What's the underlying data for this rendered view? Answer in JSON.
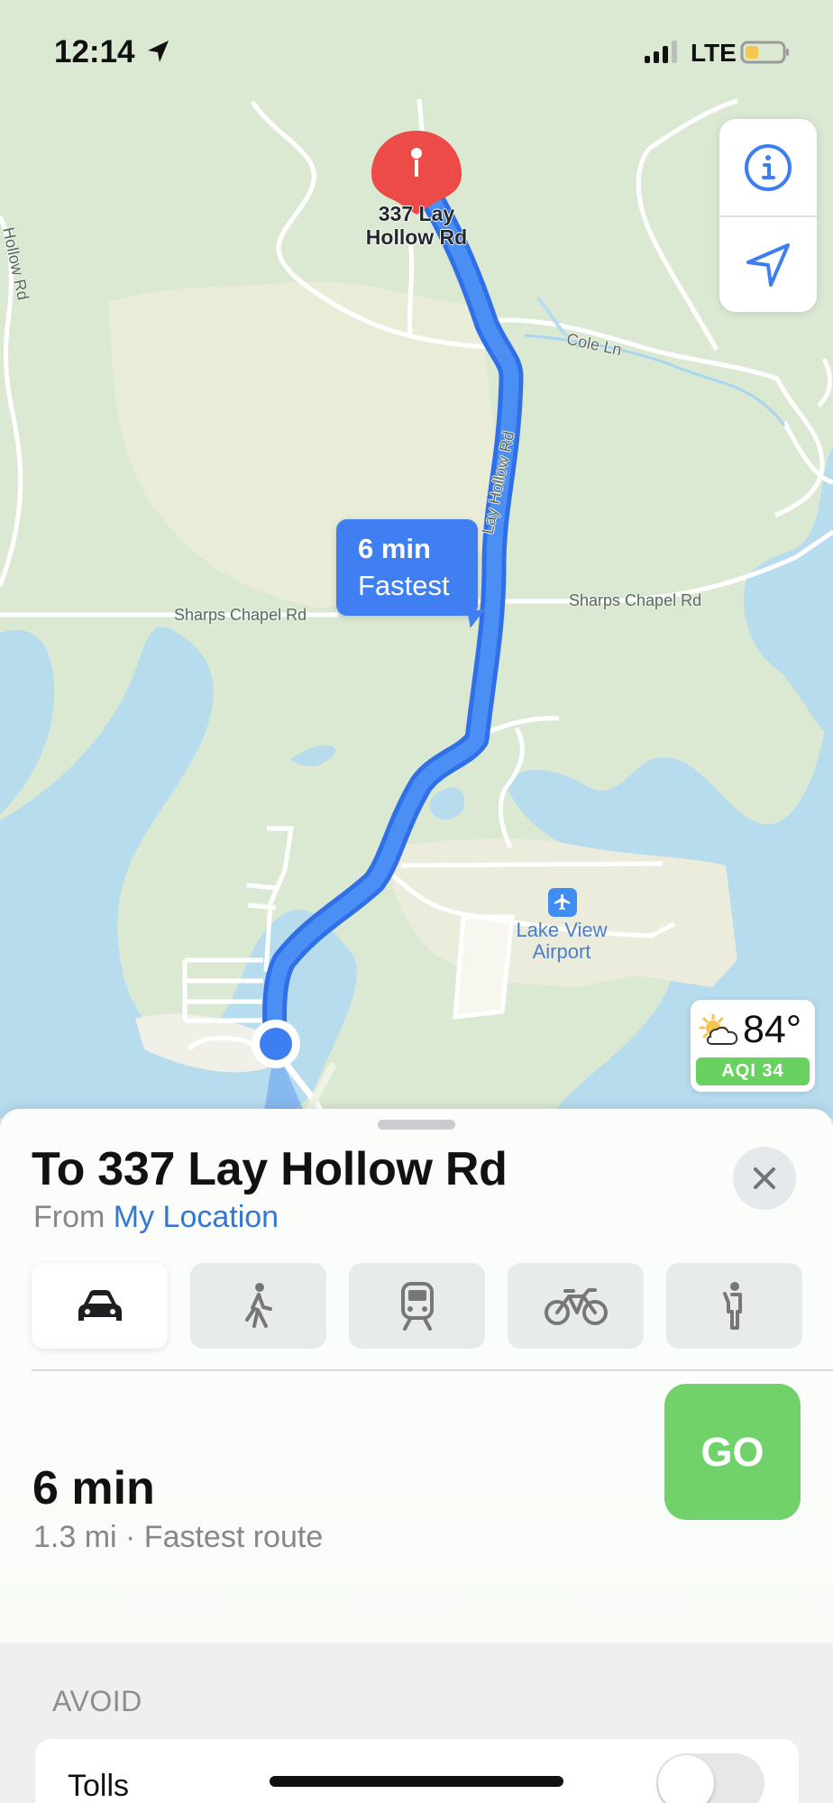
{
  "status_bar": {
    "time": "12:14",
    "network": "LTE",
    "icons": [
      "location-arrow-icon",
      "cellular-signal-icon",
      "battery-icon"
    ]
  },
  "map": {
    "destination_label_line1": "337 Lay",
    "destination_label_line2": "Hollow Rd",
    "route_bubble": {
      "time": "6 min",
      "description": "Fastest"
    },
    "road_labels": {
      "cole_ln": "Cole Ln",
      "lay_hollow_rd": "Lay Hollow Rd",
      "sharps_left": "Sharps Chapel Rd",
      "sharps_right": "Sharps Chapel Rd",
      "hollow_edge": "Hollow Rd"
    },
    "airport": {
      "line1": "Lake View",
      "line2": "Airport",
      "icon": "airplane-icon"
    },
    "controls": {
      "info_icon": "info-icon",
      "location_icon": "location-arrow-icon"
    },
    "colors": {
      "route": "#3f7ff2",
      "water": "#b7dced",
      "land": "#dbe9d3",
      "destination_pin": "#ec4b48",
      "current_location": "#3d7ff1"
    }
  },
  "weather": {
    "temperature": "84°",
    "aqi": "AQI 34",
    "icon": "partly-sunny-icon",
    "aqi_color": "#69d15f"
  },
  "directions_sheet": {
    "title": "To 337 Lay Hollow Rd",
    "from_prefix": "From",
    "from_location": "My Location",
    "close_icon": "close-icon",
    "modes": [
      {
        "name": "drive",
        "icon": "car-icon",
        "selected": true
      },
      {
        "name": "walk",
        "icon": "walking-icon",
        "selected": false
      },
      {
        "name": "transit",
        "icon": "train-icon",
        "selected": false
      },
      {
        "name": "cycle",
        "icon": "bicycle-icon",
        "selected": false
      },
      {
        "name": "ride",
        "icon": "rideshare-icon",
        "selected": false
      }
    ],
    "route": {
      "time": "6 min",
      "details": "1.3 mi · Fastest route",
      "go_label": "GO",
      "go_color": "#71d26b"
    },
    "avoid": {
      "heading": "AVOID",
      "tolls_label": "Tolls",
      "tolls_enabled": false
    }
  }
}
